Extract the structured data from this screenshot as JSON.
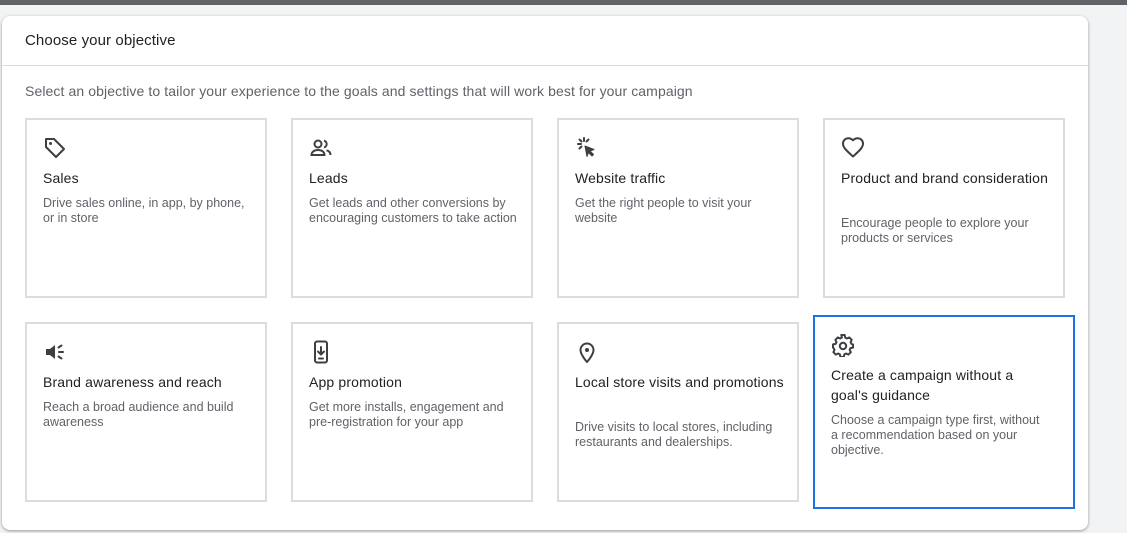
{
  "header": {
    "title": "Choose your objective"
  },
  "subtitle": "Select an objective to tailor your experience to the goals and settings that will work best for your campaign",
  "accent_color": "#1a73e8",
  "objectives": [
    {
      "icon": "tag-icon",
      "title": "Sales",
      "description": "Drive sales online, in app, by phone, or in store"
    },
    {
      "icon": "people-icon",
      "title": "Leads",
      "description": "Get leads and other conversions by encouraging customers to take action"
    },
    {
      "icon": "click-cursor-icon",
      "title": "Website traffic",
      "description": "Get the right people to visit your website"
    },
    {
      "icon": "heart-icon",
      "title": "Product and brand consideration",
      "description": "Encourage people to explore your products or services"
    },
    {
      "icon": "megaphone-icon",
      "title": "Brand awareness and reach",
      "description": "Reach a broad audience and build awareness"
    },
    {
      "icon": "phone-download-icon",
      "title": "App promotion",
      "description": "Get more installs, engagement and pre-registration for your app"
    },
    {
      "icon": "location-pin-icon",
      "title": "Local store visits and promotions",
      "description": "Drive visits to local stores, including restaurants and dealerships."
    },
    {
      "icon": "gear-icon",
      "title": "Create a campaign without a goal's guidance",
      "description": "Choose a campaign type first, without a recommendation based on your objective.",
      "selected": true
    }
  ]
}
